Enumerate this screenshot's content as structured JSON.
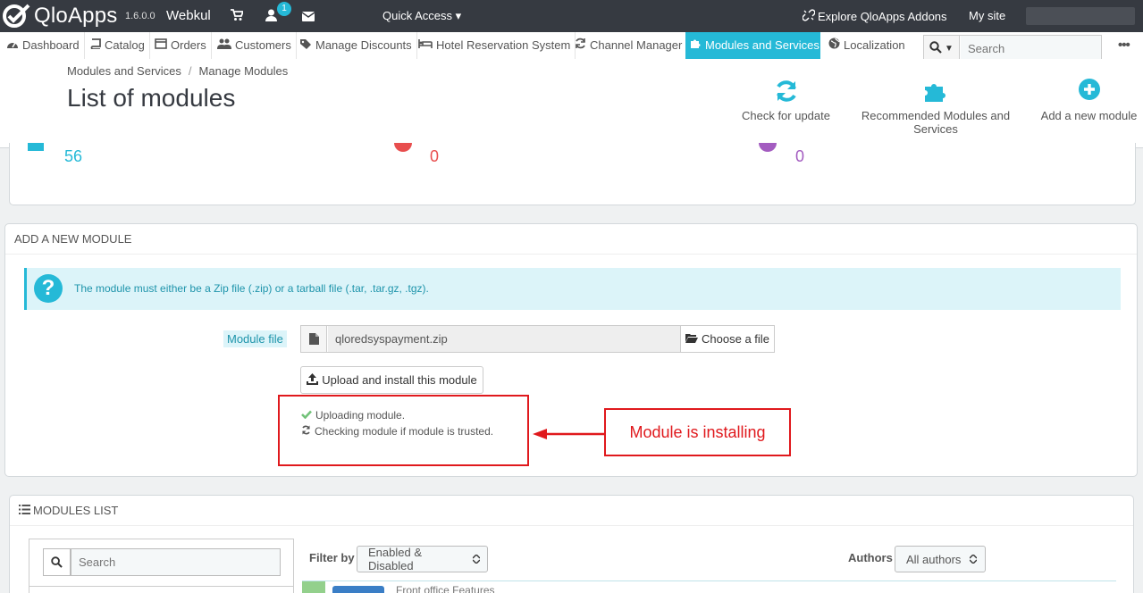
{
  "topbar": {
    "logo_text": "QloApps",
    "version": "1.6.0.0",
    "shop_name": "Webkul",
    "notification_count": "1",
    "quick_access": "Quick Access",
    "explore_addons": "Explore QloApps Addons",
    "my_site": "My site"
  },
  "nav": {
    "items": [
      {
        "label": "Dashboard",
        "icon": "dashboard-icon"
      },
      {
        "label": "Catalog",
        "icon": "book-icon"
      },
      {
        "label": "Orders",
        "icon": "orders-icon"
      },
      {
        "label": "Customers",
        "icon": "users-icon"
      },
      {
        "label": "Manage Discounts",
        "icon": "tag-icon"
      },
      {
        "label": "Hotel Reservation System",
        "icon": "bed-icon"
      },
      {
        "label": "Channel Manager",
        "icon": "refresh-icon"
      },
      {
        "label": "Modules and Services",
        "icon": "puzzle-icon"
      },
      {
        "label": "Localization",
        "icon": "globe-icon"
      }
    ],
    "active": "Modules and Services",
    "search_placeholder": "Search"
  },
  "header": {
    "breadcrumb_parent": "Modules and Services",
    "breadcrumb_current": "Manage Modules",
    "title": "List of modules",
    "toolbar": {
      "check_update": "Check for update",
      "recommended": "Recommended Modules and Services",
      "add_new": "Add a new module"
    }
  },
  "stats": {
    "installed": "56",
    "disabled": "0",
    "upgrade": "0"
  },
  "add_module": {
    "heading": "Add a new module",
    "alert": "The module must either be a Zip file (.zip) or a tarball file (.tar, .tar.gz, .tgz).",
    "file_label": "Module file",
    "file_name": "qloredsyspayment.zip",
    "choose_file": "Choose a file",
    "upload_button": "Upload and install this module",
    "progress_uploading": "Uploading module.",
    "progress_checking": "Checking module if module is trusted.",
    "callout": "Module is installing"
  },
  "modules_list": {
    "heading": "Modules list",
    "search_placeholder": "Search",
    "filter_label": "Filter by",
    "filter_value": "Enabled & Disabled",
    "authors_label": "Authors",
    "authors_value": "All authors",
    "first_module_category": "Front office Features"
  },
  "colors": {
    "topbar_bg": "#363a41",
    "accent": "#25b9d7",
    "annotation_red": "#e0191d",
    "success_green": "#72c279"
  }
}
